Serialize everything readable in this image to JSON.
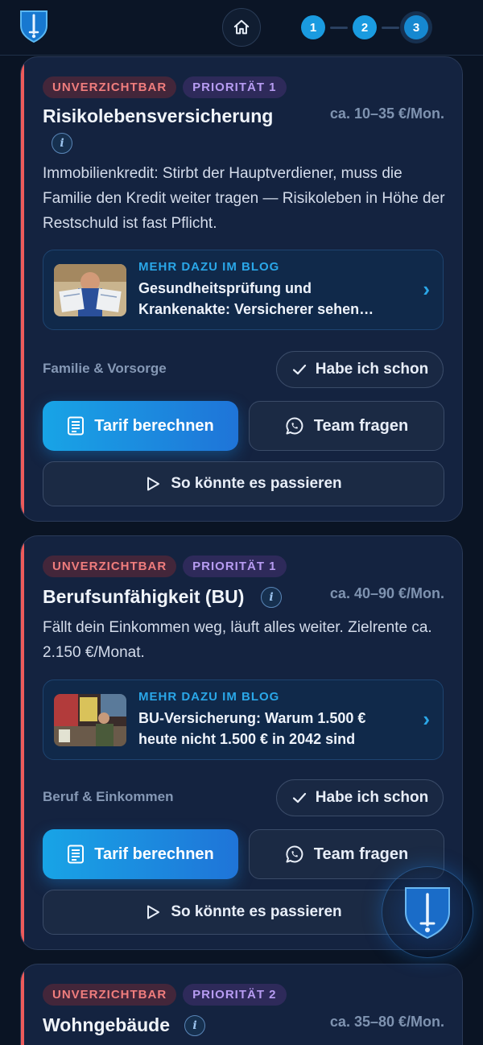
{
  "header": {
    "home_icon": "home-icon",
    "steps": [
      "1",
      "2",
      "3"
    ],
    "active_step": "3"
  },
  "cards": [
    {
      "badges": [
        "UNVERZICHTBAR",
        "PRIORITÄT 1"
      ],
      "title": "Risikolebensversicherung",
      "price": "ca. 10–35 €/Mon.",
      "description": "Immobilienkredit: Stirbt der Hauptverdiener, muss die Familie den Kredit weiter tragen — Risikoleben in Höhe der Restschuld ist fast Pflicht.",
      "blog": {
        "kicker": "MEHR DAZU IM BLOG",
        "title": "Gesundheitsprüfung und\nKrankenakte: Versicherer sehen…"
      },
      "category": "Familie & Vorsorge",
      "have_label": "Habe ich schon",
      "tarif_label": "Tarif berechnen",
      "team_label": "Team fragen",
      "scenario_label": "So könnte es passieren"
    },
    {
      "badges": [
        "UNVERZICHTBAR",
        "PRIORITÄT 1"
      ],
      "title": "Berufsunfähigkeit (BU)",
      "price": "ca. 40–90 €/Mon.",
      "description": "Fällt dein Einkommen weg, läuft alles weiter. Zielrente ca. 2.150 €/Monat.",
      "blog": {
        "kicker": "MEHR DAZU IM BLOG",
        "title": "BU-Versicherung: Warum 1.500 €\nheute nicht 1.500 € in 2042 sind"
      },
      "category": "Beruf & Einkommen",
      "have_label": "Habe ich schon",
      "tarif_label": "Tarif berechnen",
      "team_label": "Team fragen",
      "scenario_label": "So könnte es passieren"
    },
    {
      "badges": [
        "UNVERZICHTBAR",
        "PRIORITÄT 2"
      ],
      "title": "Wohngebäude",
      "price": "ca. 35–80 €/Mon."
    }
  ],
  "colors": {
    "background": "#0a1424",
    "card": "#142340",
    "accent_red": "#ec5b5b",
    "accent_blue": "#1a9be0"
  }
}
